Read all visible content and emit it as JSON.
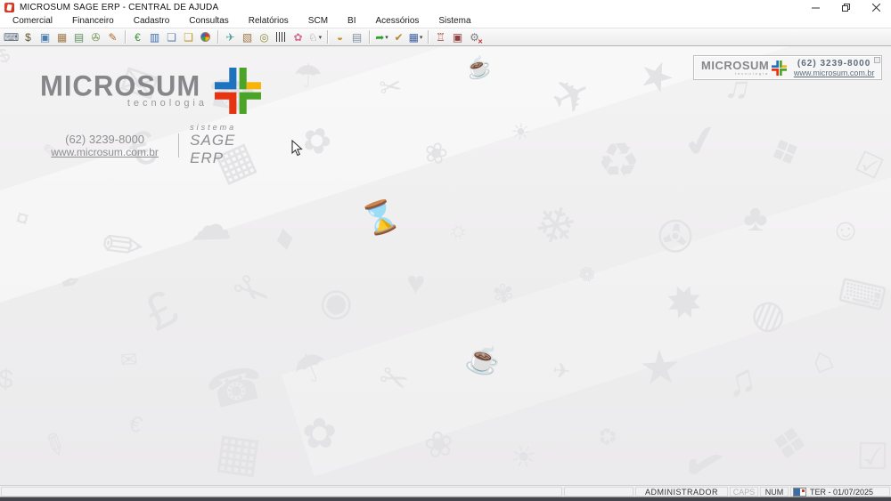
{
  "window": {
    "title": "MICROSUM SAGE ERP - CENTRAL DE AJUDA",
    "controls": [
      "minimize",
      "maximize",
      "close"
    ]
  },
  "menu": {
    "items": [
      "Comercial",
      "Financeiro",
      "Cadastro",
      "Consultas",
      "Relatórios",
      "SCM",
      "BI",
      "Acessórios",
      "Sistema"
    ]
  },
  "toolbar": {
    "groups": [
      {
        "icons": [
          {
            "name": "pos-terminal-icon",
            "glyph": "⌨",
            "color": "#5f6f7f"
          },
          {
            "name": "money-bag-icon",
            "glyph": "$",
            "color": "#5f5a2a"
          },
          {
            "name": "pc-sale-icon",
            "glyph": "▣",
            "color": "#4f7faf"
          },
          {
            "name": "package-icon",
            "glyph": "▦",
            "color": "#a07a4a"
          },
          {
            "name": "cabinet-icon",
            "glyph": "▤",
            "color": "#5f8f5f"
          },
          {
            "name": "scale-device-icon",
            "glyph": "✇",
            "color": "#6f8f4f"
          },
          {
            "name": "notepad-icon",
            "glyph": "✎",
            "color": "#b06a2f"
          }
        ]
      },
      {
        "icons": [
          {
            "name": "leaf-money-icon",
            "glyph": "€",
            "color": "#3f8f3f"
          },
          {
            "name": "chart-icon",
            "glyph": "▥",
            "color": "#3f6faf"
          },
          {
            "name": "copy-documents-icon",
            "glyph": "❏",
            "color": "#5f87af"
          },
          {
            "name": "money-transfer-icon",
            "glyph": "❑",
            "color": "#c09a27"
          },
          {
            "name": "globe-icon",
            "shape": "globe"
          }
        ]
      },
      {
        "icons": [
          {
            "name": "dove-icon",
            "glyph": "✈",
            "color": "#4f9f9f"
          },
          {
            "name": "box-icon",
            "glyph": "▧",
            "color": "#9f7a4a"
          },
          {
            "name": "search-price-icon",
            "glyph": "◎",
            "color": "#8f8f3f"
          },
          {
            "name": "barcode-icon",
            "shape": "barcode"
          },
          {
            "name": "flowers-icon",
            "glyph": "✿",
            "color": "#cf6f8f"
          },
          {
            "name": "rabbit-icon",
            "glyph": "♘",
            "color": "#8f8f93",
            "dropdown": true
          }
        ]
      },
      {
        "icons": [
          {
            "name": "basket-icon",
            "glyph": "◒",
            "color": "#c98f2f"
          },
          {
            "name": "clipboard-icon",
            "glyph": "▤",
            "color": "#7f8f9f"
          }
        ]
      },
      {
        "icons": [
          {
            "name": "forward-arrow-icon",
            "glyph": "➦",
            "color": "#2f9f2f",
            "dropdown": true
          },
          {
            "name": "edit-check-icon",
            "glyph": "✔",
            "color": "#b0892f"
          },
          {
            "name": "calculator-book-icon",
            "glyph": "▦",
            "color": "#3f5f9f",
            "dropdown": true
          }
        ]
      },
      {
        "icons": [
          {
            "name": "freight-icon",
            "glyph": "♖",
            "color": "#9f3f2f"
          },
          {
            "name": "monitor-alert-icon",
            "glyph": "▣",
            "color": "#8f3f3f"
          },
          {
            "name": "gear-remove-icon",
            "glyph": "⚙",
            "color": "#7f7f83",
            "badge": "✕",
            "badgeColor": "#d22222"
          }
        ]
      }
    ]
  },
  "brand": {
    "name": "MICROSUM",
    "tagline": "tecnologia",
    "phone": "(62) 3239-8000",
    "website": "www.microsum.com.br",
    "system_label": "sistema",
    "system_name": "SAGE ERP",
    "colors": {
      "blue": "#1e73be",
      "green": "#4ba427",
      "yellow": "#f7b50c",
      "red": "#e63312",
      "gray": "#87868a"
    }
  },
  "infobox": {
    "name": "MICROSUM",
    "tagline": "tecnologia",
    "phone": "(62) 3239-8000",
    "website": "www.microsum.com.br"
  },
  "status": {
    "user": "ADMINISTRADOR",
    "caps": "CAPS",
    "num": "NUM",
    "date": "TER - 01/07/2025"
  },
  "watermark": {
    "glyphs": [
      "$",
      "✉",
      "☎",
      "☂",
      "✂",
      "☕",
      "✈",
      "★",
      "♫",
      "⌂",
      "✎",
      "€",
      "▦",
      "✿",
      "❀",
      "☀",
      "♻",
      "✔",
      "❖",
      "☑",
      "¤",
      "✏",
      "☁",
      "♦",
      "⌛",
      "☼",
      "❄",
      "✇",
      "♣",
      "☺",
      "✒",
      "£",
      "✁",
      "◉",
      "♥",
      "✾",
      "❁",
      "✸",
      "◍",
      "⌨"
    ]
  }
}
